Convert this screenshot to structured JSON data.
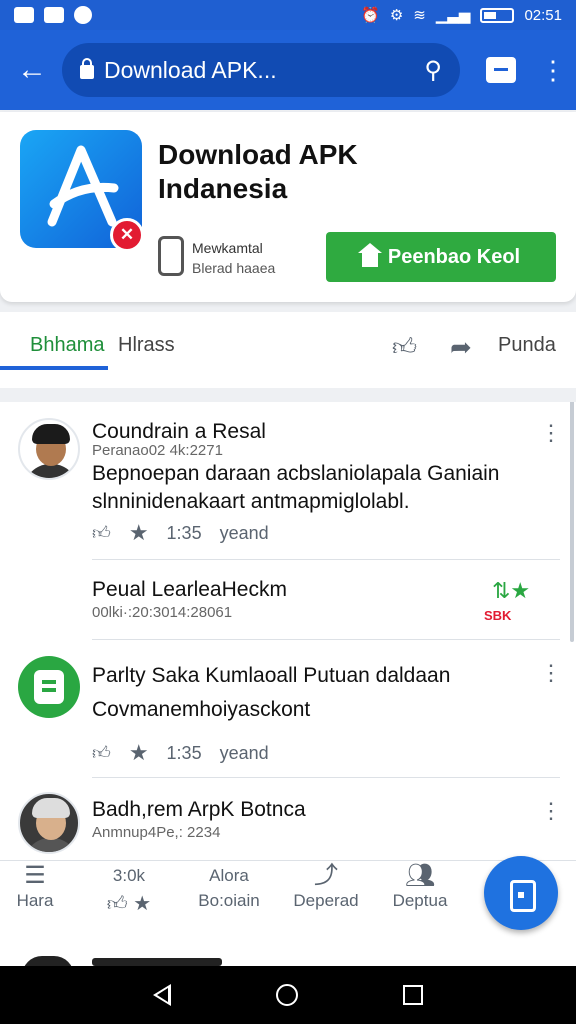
{
  "status_bar": {
    "time": "02:51"
  },
  "app_bar": {
    "url_text": "Download  APK..."
  },
  "app_card": {
    "title": "Download APK Indanesia",
    "developer": "Mewkamtal",
    "developer_sub": "Blerad haaea",
    "install_label": "Peenbao Keol"
  },
  "tabs": {
    "active": "Bhhama",
    "second": "Hlrass",
    "share_label": "Punda"
  },
  "posts": [
    {
      "title": "Coundrain a Resal",
      "meta": "Peranao02 4k:2271",
      "body": "Bepnoepan daraan acbslaniolapala Ganiain slnninidenakaart antmapmiglolabl.",
      "stat": "1:35",
      "stat_label": "yeand"
    },
    {
      "title": "Peual LearleaHeckm",
      "meta": "00lki·:20:3014:28061",
      "badge_red": "SBK"
    },
    {
      "title": "Parlty Saka Kumlaoall Putuan daldaan",
      "body": "Covmanemhoiyasckont",
      "stat": "1:35",
      "stat_label": "yeand"
    },
    {
      "title": "Badh,rem ArpK Botnca",
      "meta": "Anmnup4Pe,: 2234"
    }
  ],
  "bottom_nav": [
    {
      "label": "Hara",
      "icon": "list-icon"
    },
    {
      "label": "3:0k",
      "icon": "thumb-icon"
    },
    {
      "label": "Alora",
      "sub": "Bo:oiain"
    },
    {
      "label": "Deperad",
      "icon": "trending-icon"
    },
    {
      "label": "Deptua",
      "icon": "people-icon"
    }
  ]
}
